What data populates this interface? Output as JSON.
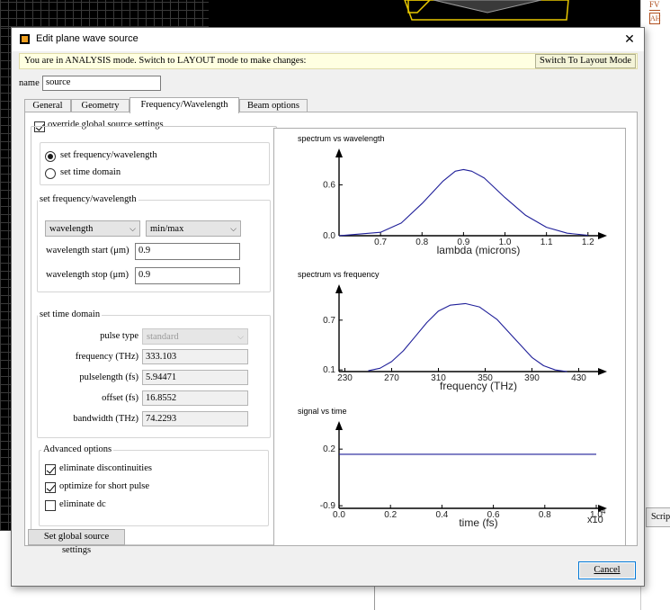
{
  "background": {
    "right_tab_label": "Scrip",
    "right_icon_1": "FV",
    "right_icon_2": "AH"
  },
  "dialog": {
    "title": "Edit plane wave source",
    "close_glyph": "✕",
    "mode_message": "You are in ANALYSIS mode.  Switch to LAYOUT mode to make changes:",
    "switch_layout_button": "Switch To Layout Mode",
    "name_label": "name",
    "name_value": "source",
    "tabs": [
      "General",
      "Geometry",
      "Frequency/Wavelength",
      "Beam options"
    ],
    "active_tab": "Frequency/Wavelength",
    "override_label": "override global source settings",
    "override_checked": true,
    "mode_radio": {
      "option_freq": "set frequency/wavelength",
      "option_time": "set time domain",
      "selected": "set frequency/wavelength"
    },
    "freq_group": {
      "title": "set frequency/wavelength",
      "type_select": "wavelength",
      "range_select": "min/max",
      "start_label": "wavelength start (μm)",
      "start_value": "0.9",
      "stop_label": "wavelength stop (μm)",
      "stop_value": "0.9"
    },
    "time_group": {
      "title": "set time domain",
      "pulse_type_label": "pulse type",
      "pulse_type_value": "standard",
      "frequency_label": "frequency (THz)",
      "frequency_value": "333.103",
      "pulselength_label": "pulselength (fs)",
      "pulselength_value": "5.94471",
      "offset_label": "offset (fs)",
      "offset_value": "16.8552",
      "bandwidth_label": "bandwidth (THz)",
      "bandwidth_value": "74.2293"
    },
    "advanced": {
      "title": "Advanced options",
      "eliminate_discontinuities": "eliminate discontinuities",
      "eliminate_discontinuities_checked": true,
      "optimize_short_pulse": "optimize for short pulse",
      "optimize_short_pulse_checked": true,
      "eliminate_dc": "eliminate dc",
      "eliminate_dc_checked": false
    },
    "set_global_button": "Set global source settings",
    "cancel_button": "Cancel"
  },
  "chart_data": [
    {
      "type": "line",
      "title": "spectrum vs wavelength",
      "xlabel": "lambda (microns)",
      "xlim": [
        0.6,
        1.22
      ],
      "ylim": [
        0,
        0.88
      ],
      "xticks": [
        0.7,
        0.8,
        0.9,
        1.0,
        1.1,
        1.2
      ],
      "xtick_labels": [
        "0.7",
        "0.8",
        "0.9",
        "1.0",
        "1.1",
        "1.2"
      ],
      "yticks": [
        0.0,
        0.6
      ],
      "ytick_labels": [
        "0.0",
        "0.6"
      ],
      "color": "#1f1f99",
      "series": [
        {
          "x": [
            0.6,
            0.7,
            0.75,
            0.8,
            0.85,
            0.88,
            0.9,
            0.92,
            0.95,
            1.0,
            1.05,
            1.1,
            1.15,
            1.2
          ],
          "y": [
            0.0,
            0.04,
            0.15,
            0.38,
            0.64,
            0.76,
            0.78,
            0.76,
            0.68,
            0.45,
            0.24,
            0.1,
            0.03,
            0.005
          ]
        }
      ]
    },
    {
      "type": "line",
      "title": "spectrum vs frequency",
      "xlabel": "frequency (THz)",
      "xlim": [
        225,
        445
      ],
      "ylim": [
        0.08,
        0.98
      ],
      "xticks": [
        230,
        270,
        310,
        350,
        390,
        430
      ],
      "xtick_labels": [
        "230",
        "270",
        "310",
        "350",
        "390",
        "430"
      ],
      "yticks": [
        0.1,
        0.7
      ],
      "ytick_labels": [
        "0.1",
        "0.7"
      ],
      "color": "#1f1f99",
      "series": [
        {
          "x": [
            250,
            260,
            270,
            280,
            290,
            300,
            310,
            320,
            333,
            345,
            360,
            375,
            390,
            400,
            410,
            420
          ],
          "y": [
            0.09,
            0.12,
            0.2,
            0.33,
            0.5,
            0.67,
            0.81,
            0.88,
            0.9,
            0.86,
            0.71,
            0.48,
            0.25,
            0.15,
            0.1,
            0.08
          ]
        }
      ]
    },
    {
      "type": "line",
      "title": "signal vs time",
      "xlabel": "time (fs)",
      "x_multiplier": "x10",
      "x_multiplier_exp": "4",
      "xlim": [
        0,
        1.0
      ],
      "ylim": [
        -0.95,
        0.5
      ],
      "xticks": [
        0.0,
        0.2,
        0.4,
        0.6,
        0.8,
        1.0
      ],
      "xtick_labels": [
        "0.0",
        "0.2",
        "0.4",
        "0.6",
        "0.8",
        "1.0"
      ],
      "yticks": [
        0.2,
        -0.9
      ],
      "ytick_labels": [
        "0.2",
        "-0.9"
      ],
      "color": "#1f1f99",
      "series": [
        {
          "x": [
            0.0,
            1.0
          ],
          "y": [
            0.1,
            0.1
          ]
        }
      ]
    }
  ]
}
